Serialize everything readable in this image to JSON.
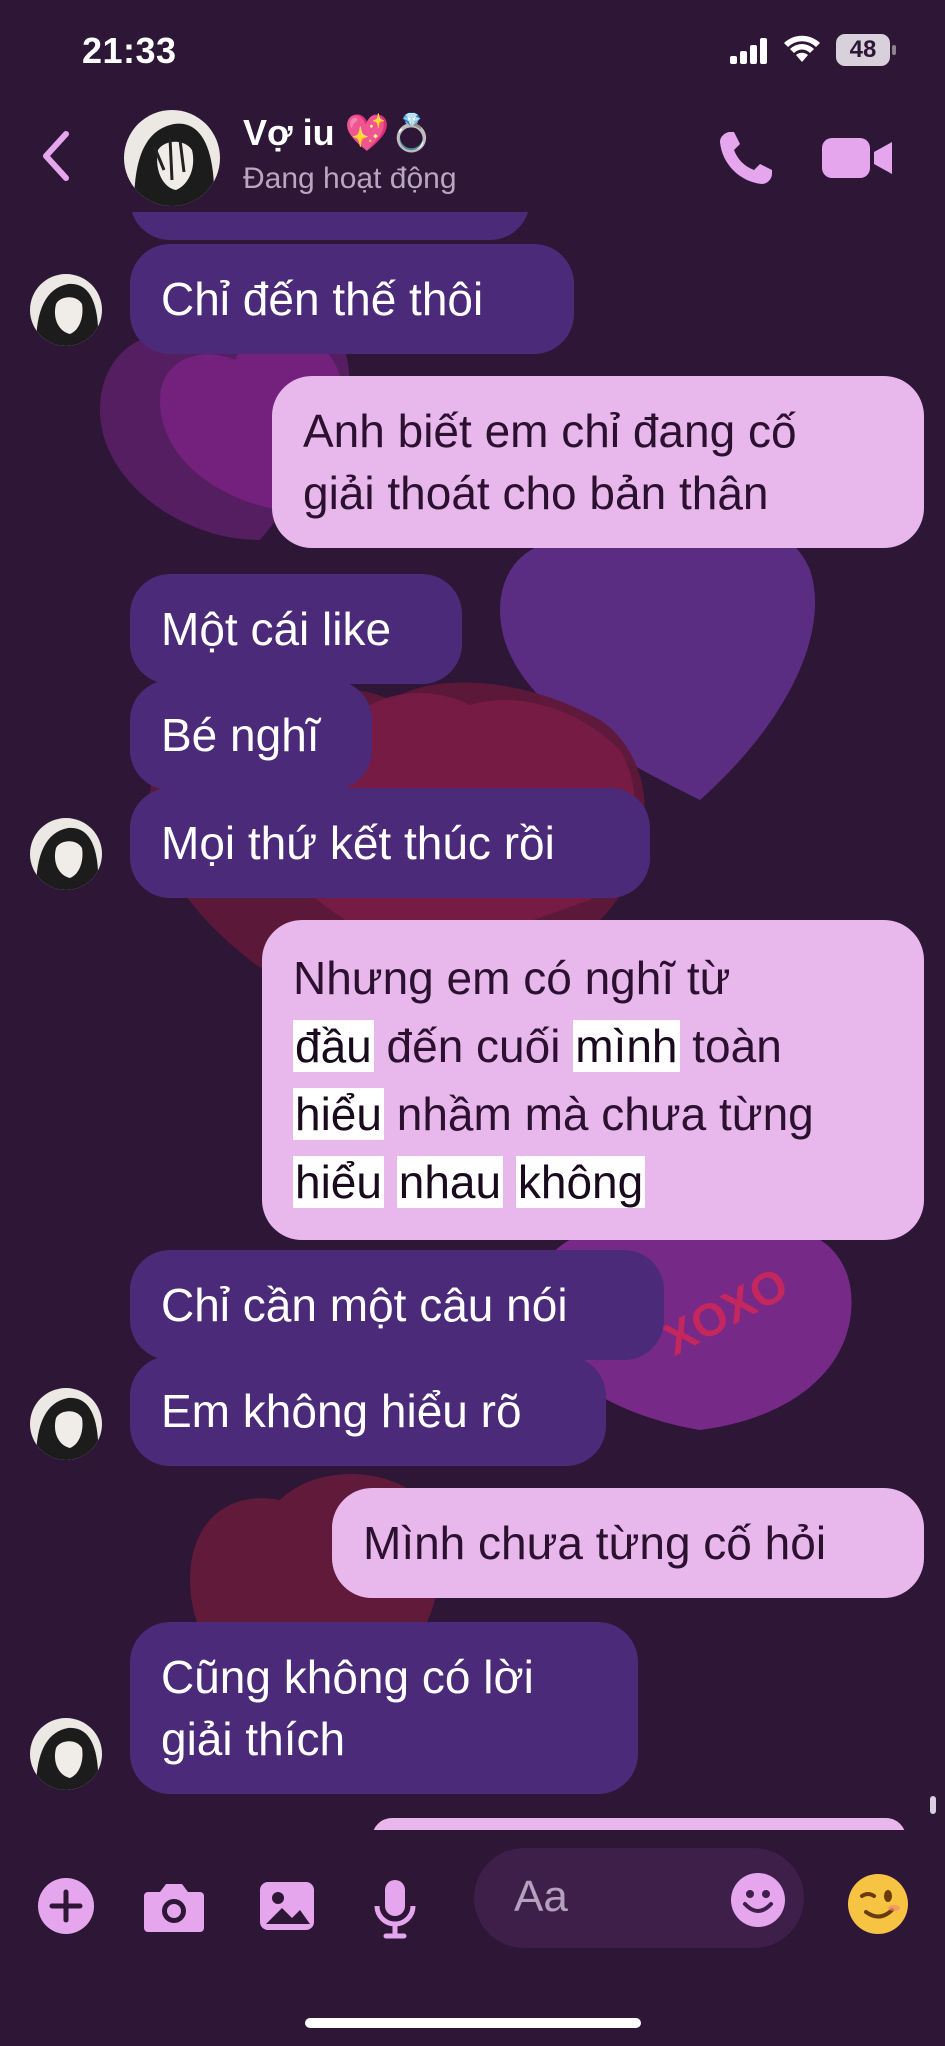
{
  "status_bar": {
    "time": "21:33",
    "battery": "48"
  },
  "header": {
    "contact_name": "Vợ iu 💖💍",
    "contact_status": "Đang hoạt động"
  },
  "messages": [
    {
      "side": "incoming",
      "text": "Chỉ đến thế thôi"
    },
    {
      "side": "outgoing",
      "lines": [
        "Anh biết em chỉ đang cố",
        "giải thoát cho bản thân"
      ]
    },
    {
      "side": "incoming",
      "text": "Một cái like"
    },
    {
      "side": "incoming",
      "text": "Bé nghĩ"
    },
    {
      "side": "incoming",
      "text": "Mọi thứ kết thúc rồi"
    },
    {
      "side": "outgoing",
      "lines": [
        "Nhưng em có nghĩ từ",
        "đầu đến cuối mình toàn",
        "hiểu nhầm mà chưa từng",
        "hiểu nhau không"
      ]
    },
    {
      "side": "incoming",
      "text": "Chỉ cần một câu nói"
    },
    {
      "side": "incoming",
      "text": "Em không hiểu rõ"
    },
    {
      "side": "outgoing",
      "text": "Mình chưa từng cố hỏi"
    },
    {
      "side": "incoming",
      "lines": [
        "Cũng không có lời",
        "giải thích"
      ]
    }
  ],
  "background_text": "XOXO",
  "composer": {
    "placeholder": "Aa",
    "icons": [
      "plus-icon",
      "camera-icon",
      "gallery-icon",
      "microphone-icon",
      "emoji-icon",
      "wink-emoji-icon"
    ],
    "accent_color": "#e6a6ee"
  },
  "colors": {
    "background": "#2e1637",
    "incoming_bubble": "#4b2a79",
    "outgoing_bubble": "#e8b8ec"
  }
}
